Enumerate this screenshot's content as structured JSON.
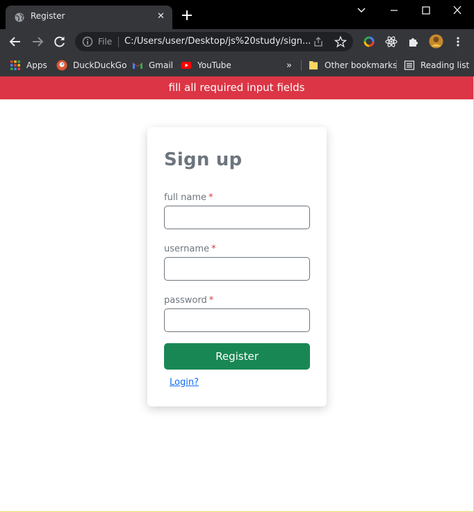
{
  "browser": {
    "tab": {
      "title": "Register",
      "close_glyph": "✕",
      "favicon": "globe-icon"
    },
    "new_tab_icon": "plus-icon",
    "window_controls": [
      "chevron-down-icon",
      "minimize-icon",
      "maximize-icon",
      "close-icon"
    ],
    "address_bar": {
      "scheme_label": "File",
      "url": "C:/Users/user/Desktop/js%20study/sign..."
    },
    "bookmarks": [
      {
        "label": "Apps",
        "icon": "apps-grid-icon"
      },
      {
        "label": "DuckDuckGo",
        "icon": "duckduckgo-icon"
      },
      {
        "label": "Gmail",
        "icon": "gmail-icon"
      },
      {
        "label": "YouTube",
        "icon": "youtube-icon"
      }
    ],
    "bookmarks_overflow": "»",
    "other_bookmarks": "Other bookmarks",
    "reading_list": "Reading list"
  },
  "page": {
    "alert": "fill all required input fields",
    "form": {
      "title": "Sign up",
      "required_mark": "*",
      "fields": [
        {
          "label": "full name",
          "value": ""
        },
        {
          "label": "username",
          "value": ""
        },
        {
          "label": "password",
          "value": ""
        }
      ],
      "submit_label": "Register",
      "login_link": "Login?"
    }
  },
  "colors": {
    "alert_bg": "#dc3545",
    "submit_bg": "#198754",
    "link": "#0d6efd",
    "title_text": "#6c757d"
  }
}
